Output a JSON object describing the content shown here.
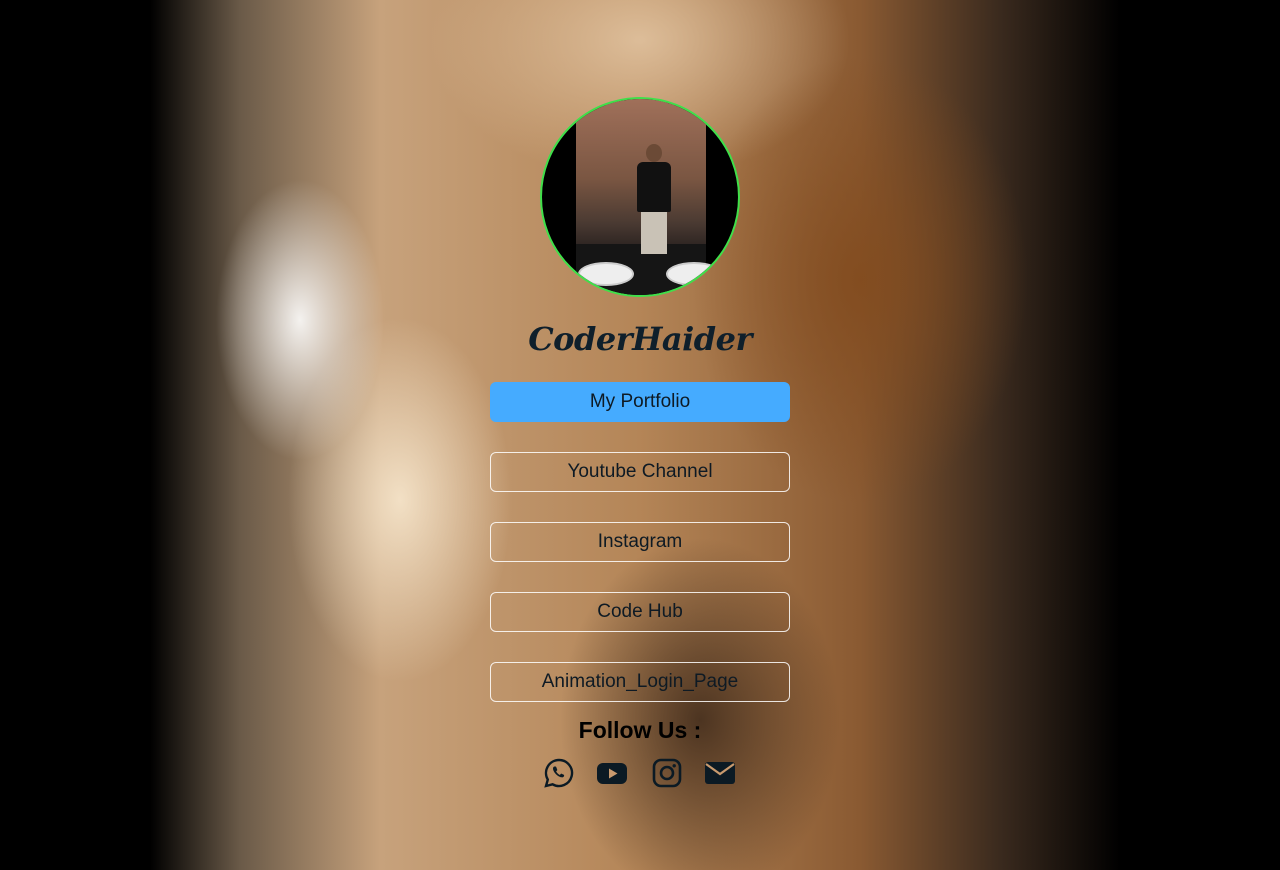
{
  "profile": {
    "name": "CoderHaider"
  },
  "links": [
    {
      "label": "My Portfolio",
      "active": true
    },
    {
      "label": "Youtube Channel",
      "active": false
    },
    {
      "label": "Instagram",
      "active": false
    },
    {
      "label": "Code Hub",
      "active": false
    },
    {
      "label": "Animation_Login_Page",
      "active": false
    }
  ],
  "follow": {
    "title": "Follow Us :",
    "icons": [
      "whatsapp-icon",
      "youtube-icon",
      "instagram-icon",
      "email-icon"
    ]
  },
  "colors": {
    "active_button": "#45abff",
    "avatar_border": "#3fe04a",
    "text_dark": "#0e1a24"
  }
}
